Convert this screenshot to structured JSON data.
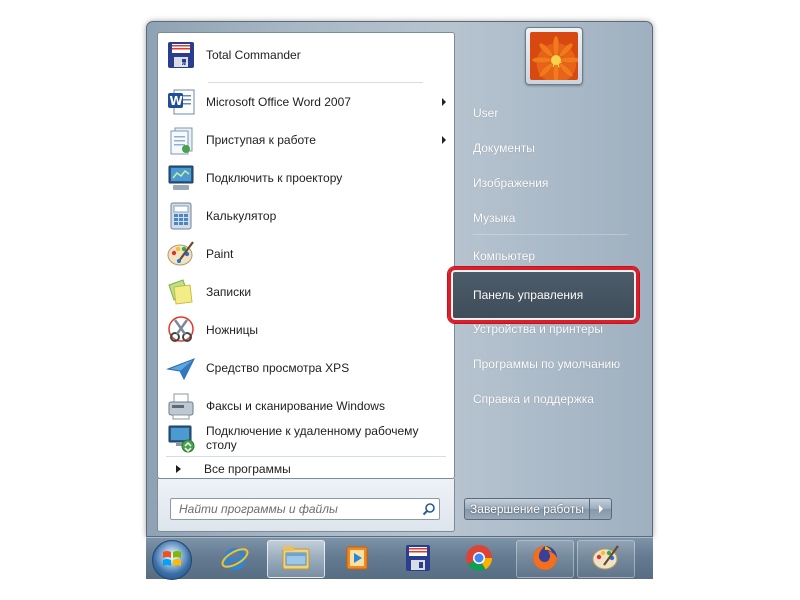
{
  "start_menu": {
    "programs": [
      {
        "label": "Total Commander",
        "icon": "total-commander-icon",
        "has_submenu": false
      },
      {
        "label": "Microsoft Office Word 2007",
        "icon": "word-icon",
        "has_submenu": true
      },
      {
        "label": "Приступая к работе",
        "icon": "getting-started-icon",
        "has_submenu": true
      },
      {
        "label": "Подключить к проектору",
        "icon": "projector-icon",
        "has_submenu": false
      },
      {
        "label": "Калькулятор",
        "icon": "calculator-icon",
        "has_submenu": false
      },
      {
        "label": "Paint",
        "icon": "paint-icon",
        "has_submenu": false
      },
      {
        "label": "Записки",
        "icon": "sticky-notes-icon",
        "has_submenu": false
      },
      {
        "label": "Ножницы",
        "icon": "snipping-tool-icon",
        "has_submenu": false
      },
      {
        "label": "Средство просмотра XPS",
        "icon": "xps-viewer-icon",
        "has_submenu": false
      },
      {
        "label": "Факсы и сканирование Windows",
        "icon": "fax-scan-icon",
        "has_submenu": false
      },
      {
        "label": "Подключение к удаленному рабочему столу",
        "icon": "remote-desktop-icon",
        "has_submenu": false
      }
    ],
    "all_programs_label": "Все программы",
    "search": {
      "placeholder": "Найти программы и файлы"
    },
    "right_pane": {
      "items": [
        {
          "label": "User"
        },
        {
          "label": "Документы"
        },
        {
          "label": "Изображения"
        },
        {
          "label": "Музыка"
        },
        {
          "label": "Компьютер"
        },
        {
          "label": "Панель управления",
          "highlighted": true
        },
        {
          "label": "Устройства и принтеры"
        },
        {
          "label": "Программы по умолчанию"
        },
        {
          "label": "Справка и поддержка"
        }
      ],
      "shutdown_label": "Завершение работы"
    }
  },
  "taskbar": {
    "items": [
      {
        "icon": "windows-start-orb-icon"
      },
      {
        "icon": "internet-explorer-icon"
      },
      {
        "icon": "file-explorer-icon",
        "active": true
      },
      {
        "icon": "media-player-icon"
      },
      {
        "icon": "total-commander-icon"
      },
      {
        "icon": "chrome-icon"
      },
      {
        "icon": "firefox-icon",
        "pinned": true
      },
      {
        "icon": "paint-icon",
        "pinned": true
      }
    ]
  },
  "colors": {
    "highlight_border": "#d9202a",
    "menu_frame": "#a9b8c6",
    "taskbar": "#647b91"
  }
}
